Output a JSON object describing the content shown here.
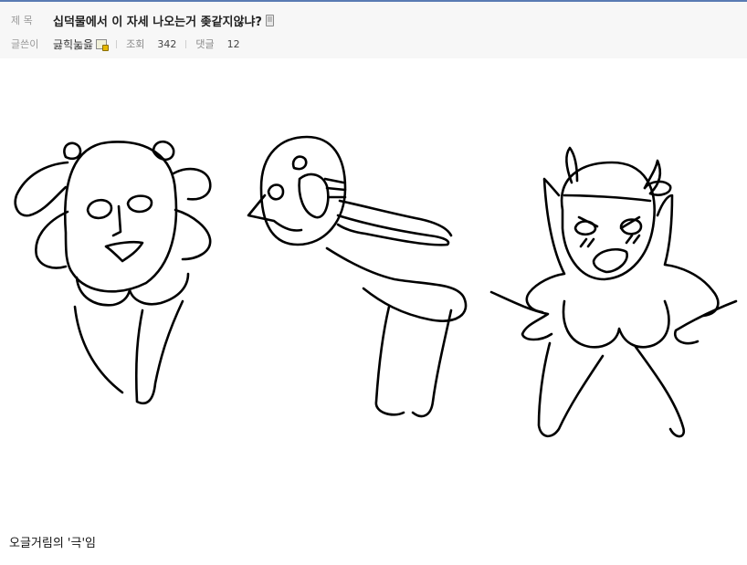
{
  "post": {
    "title_label": "제 목",
    "title": "십덕물에서 이 자세 나오는거 좆같지않냐?",
    "author_label": "글쓴이",
    "author": "긇힉눏읋",
    "views_label": "조회",
    "views": "342",
    "comments_label": "댓글",
    "comments": "12"
  },
  "content": {
    "caption": "오글거림의 '극'임"
  },
  "icons": {
    "mobile": "mobile-phone-icon",
    "member": "member-badge-icon"
  },
  "colors": {
    "header_bg": "#f7f7f7",
    "top_rule": "#5a7bb3"
  }
}
